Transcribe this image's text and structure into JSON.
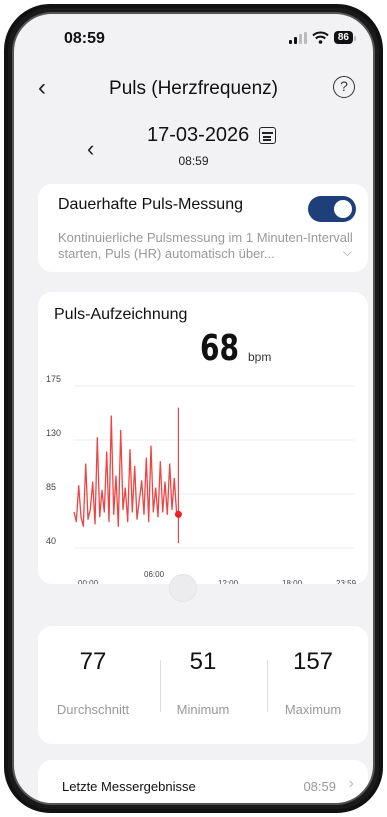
{
  "status_bar": {
    "time": "08:59",
    "battery": "86"
  },
  "nav": {
    "back_icon": "‹",
    "title": "Puls (Herzfrequenz)",
    "help_icon": "?"
  },
  "date": {
    "prev_icon": "‹",
    "date": "17-03-2026",
    "time": "08:59"
  },
  "continuous": {
    "title": "Dauerhafte Puls-Messung",
    "enabled": true,
    "description": "Kontinuierliche Pulsmessung im 1 Minuten-Intervall starten, Puls (HR) automatisch über...",
    "chevron": "⌵"
  },
  "chart": {
    "title": "Puls-Aufzeichnung",
    "current_value": "68",
    "unit": "bpm"
  },
  "chart_data": {
    "type": "line",
    "color": "#ee4444",
    "marker_color": "#ee2222",
    "xlim_hours": [
      0,
      24
    ],
    "ylim": [
      30,
      185
    ],
    "yticks": [
      40,
      85,
      130,
      175
    ],
    "xtick_labels": [
      "00:00",
      "06:00",
      "12:00",
      "18:00",
      "23:59"
    ],
    "x_hours": [
      0.0,
      0.2,
      0.4,
      0.6,
      0.8,
      1.0,
      1.2,
      1.4,
      1.6,
      1.8,
      2.0,
      2.2,
      2.4,
      2.6,
      2.8,
      3.0,
      3.2,
      3.4,
      3.6,
      3.8,
      4.0,
      4.2,
      4.4,
      4.6,
      4.8,
      5.0,
      5.2,
      5.4,
      5.6,
      5.8,
      6.0,
      6.2,
      6.4,
      6.6,
      6.8,
      7.0,
      7.2,
      7.4,
      7.6,
      7.8,
      8.0,
      8.2,
      8.4,
      8.6,
      8.8,
      8.95
    ],
    "values": [
      70,
      62,
      92,
      66,
      58,
      110,
      64,
      72,
      95,
      60,
      132,
      66,
      88,
      70,
      120,
      62,
      150,
      68,
      100,
      58,
      138,
      72,
      90,
      62,
      122,
      70,
      108,
      64,
      80,
      96,
      68,
      115,
      62,
      125,
      70,
      90,
      66,
      112,
      70,
      95,
      68,
      110,
      72,
      98,
      68,
      68
    ],
    "spike": {
      "x_hour": 8.95,
      "values": [
        44,
        157
      ]
    },
    "current_point": {
      "x_hour": 8.95,
      "value": 68
    }
  },
  "stats": {
    "average": {
      "value": "77",
      "label": "Durchschnitt"
    },
    "minimum": {
      "value": "51",
      "label": "Minimum"
    },
    "maximum": {
      "value": "157",
      "label": "Maximum"
    }
  },
  "last": {
    "label": "Letzte Messergebnisse",
    "time": "08:59",
    "chevron": "›"
  }
}
